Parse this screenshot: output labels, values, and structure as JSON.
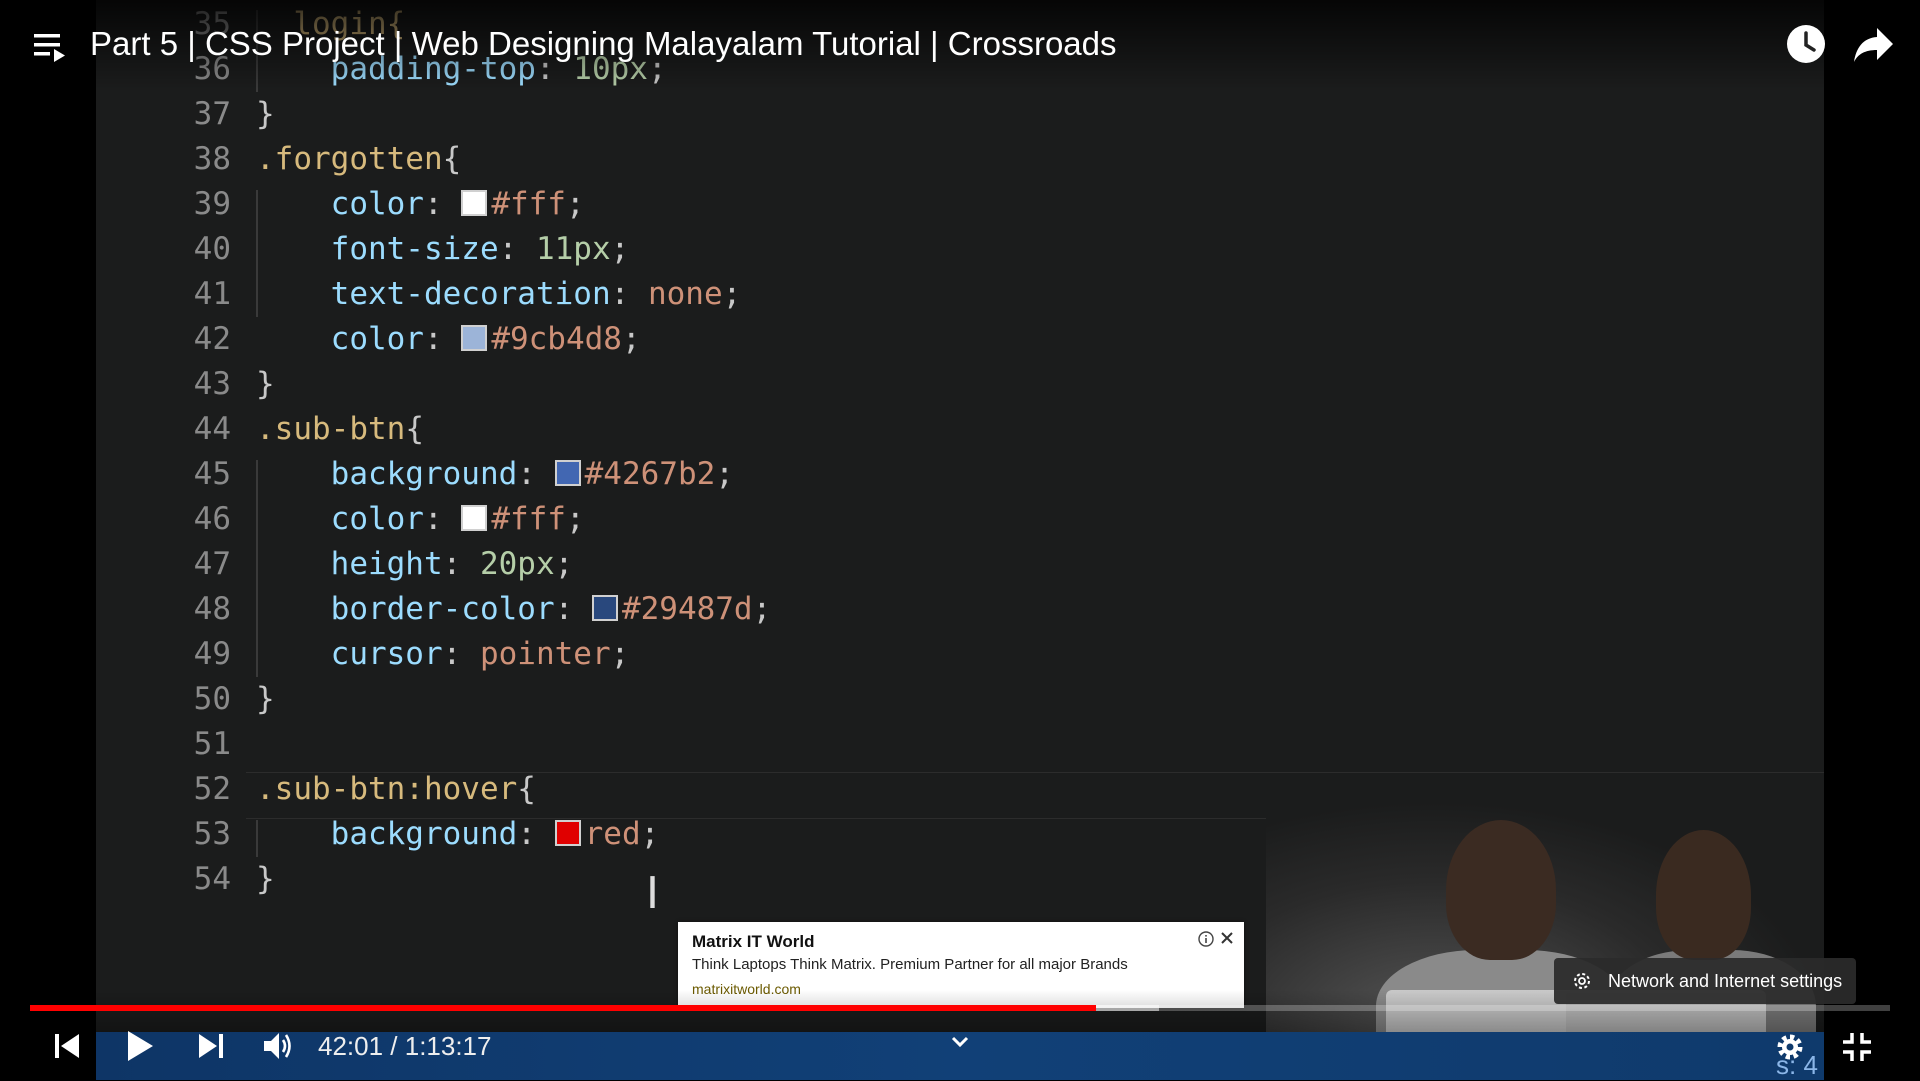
{
  "title": "Part 5 | CSS Project | Web Designing Malayalam Tutorial | Crossroads",
  "code_lines": [
    {
      "n": "35",
      "html": "<span class=\"sel\">  login{</span>"
    },
    {
      "n": "36",
      "html": "    <span class=\"prop\">padding-top</span>: <span class=\"num\">10px</span>;"
    },
    {
      "n": "37",
      "html": "}"
    },
    {
      "n": "38",
      "html": "<span class=\"sel\">.forgotten</span>{"
    },
    {
      "n": "39",
      "html": "    <span class=\"prop\">color</span>: <span class=\"sw\" style=\"background:#fff\"></span><span class=\"hex\">#fff</span>;"
    },
    {
      "n": "40",
      "html": "    <span class=\"prop\">font-size</span>: <span class=\"num\">11px</span>;"
    },
    {
      "n": "41",
      "html": "    <span class=\"prop\">text-decoration</span>: <span class=\"str\">none</span>;"
    },
    {
      "n": "42",
      "html": "    <span class=\"prop\">color</span>: <span class=\"sw\" style=\"background:#9cb4d8\"></span><span class=\"hex\">#9cb4d8</span>;"
    },
    {
      "n": "43",
      "html": "}"
    },
    {
      "n": "44",
      "html": "<span class=\"sel\">.sub-btn</span>{"
    },
    {
      "n": "45",
      "html": "    <span class=\"prop\">background</span>: <span class=\"sw\" style=\"background:#4267b2\"></span><span class=\"hex\">#4267b2</span>;"
    },
    {
      "n": "46",
      "html": "    <span class=\"prop\">color</span>: <span class=\"sw\" style=\"background:#fff\"></span><span class=\"hex\">#fff</span>;"
    },
    {
      "n": "47",
      "html": "    <span class=\"prop\">height</span>: <span class=\"num\">20px</span>;"
    },
    {
      "n": "48",
      "html": "    <span class=\"prop\">border-color</span>: <span class=\"sw\" style=\"background:#29487d\"></span><span class=\"hex\">#29487d</span>;"
    },
    {
      "n": "49",
      "html": "    <span class=\"prop\">cursor</span>: <span class=\"str\">pointer</span>;"
    },
    {
      "n": "50",
      "html": "}"
    },
    {
      "n": "51",
      "html": ""
    },
    {
      "n": "52",
      "html": "<span class=\"sel\">.sub-btn:hover</span>{"
    },
    {
      "n": "53",
      "html": "    <span class=\"prop\">background</span>: <span class=\"sw\" style=\"background:#e00000\"></span><span class=\"str\">red</span>;"
    },
    {
      "n": "54",
      "html": "}"
    }
  ],
  "ad": {
    "title": "Matrix IT World",
    "description": "Think Laptops Think Matrix. Premium Partner for all major Brands",
    "url": "matrixitworld.com"
  },
  "toast": {
    "text": "Network and Internet settings"
  },
  "player": {
    "time_display": "42:01 / 1:13:17",
    "played_fraction": 0.573,
    "buffered_fraction": 0.607,
    "accent_color": "#ff0000"
  },
  "icons": [
    "playlist-icon",
    "watch-later-icon",
    "share-icon",
    "previous-icon",
    "play-icon",
    "next-icon",
    "volume-icon",
    "chevron-down-icon",
    "settings-icon",
    "exit-fullscreen-icon",
    "info-icon",
    "close-icon",
    "gear-icon"
  ]
}
